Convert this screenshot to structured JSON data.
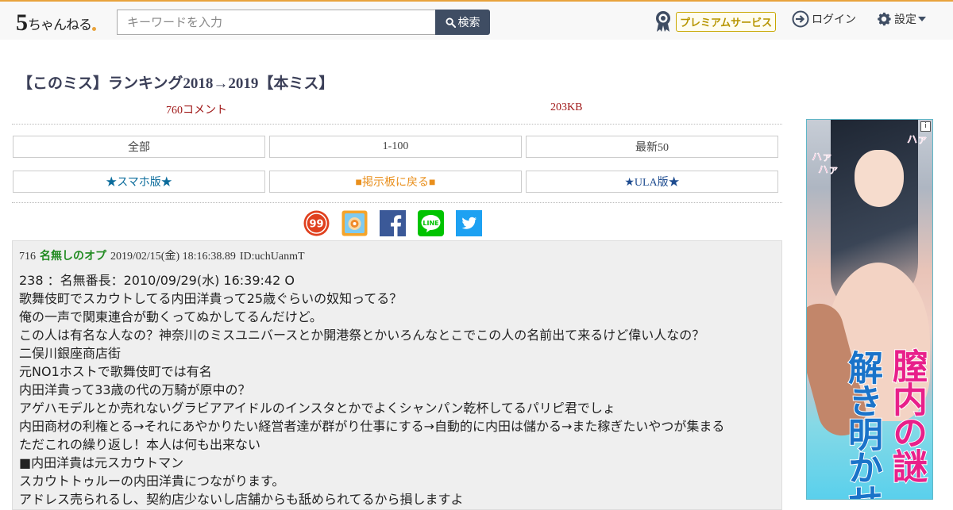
{
  "header": {
    "logo_five": "5",
    "logo_text": "ちゃんねる",
    "search_placeholder": "キーワードを入力",
    "search_button": "検索",
    "premium_label": "プレミアムサービス",
    "login_label": "ログイン",
    "settings_label": "設定",
    "accent_color": "#e8a33c"
  },
  "thread": {
    "title": "【このミス】ランキング2018→2019【本ミス】",
    "comments": "760コメント",
    "size": "203KB"
  },
  "nav": {
    "all": "全部",
    "range": "1-100",
    "latest": "最新50",
    "smartphone": "★スマホ版★",
    "back_to_board": "■掲示板に戻る■",
    "ula": "★ULA版★"
  },
  "share": {
    "icons": [
      "sukima-icon",
      "hatena-icon",
      "facebook-icon",
      "line-icon",
      "twitter-icon"
    ],
    "line_label": "LINE",
    "sukima_label": "99",
    "facebook_color": "#3b5998",
    "line_color": "#00c300",
    "twitter_color": "#1da1f2"
  },
  "post": {
    "number": "716",
    "name": "名無しのオプ",
    "date": "2019/02/15(金) 18:16:38.89",
    "id": "ID:uchUanmT",
    "lines": [
      "238 ：名無番長：2010/09/29(水) 16:39:42 O",
      "歌舞伎町でスカウトしてる内田洋貴って25歳ぐらいの奴知ってる？",
      "俺の一声で関東連合が動くってぬかしてるんだけど。",
      "この人は有名な人なの？神奈川のミスユニバースとか開港祭とかいろんなとこでこの人の名前出て来るけど偉い人なの？",
      "二俣川銀座商店街",
      "元NO1ホストで歌舞伎町では有名",
      "内田洋貴って33歳の代の万騎が原中の？",
      "アゲハモデルとか売れないグラビアアイドルのインスタとかでよくシャンパン乾杯してるパリピ君でしょ",
      "内田商材の利権とる→それにあやかりたい経営者達が群がり仕事にする→自動的に内田は儲かる→また稼ぎたいやつが集まる",
      "ただこれの繰り返し！本人は何も出来ない",
      "■内田洋貴は元スカウトマン",
      "スカウトトゥルーの内田洋貴につながります。",
      "アドレス売られるし、契約店少ないし店舗からも舐められてるから損しますよ"
    ]
  },
  "ad": {
    "info_label": "i",
    "sound1": "ハァ",
    "sound2": "ハァ",
    "sound3": "ハァ",
    "title_col1": "膣内の謎",
    "title_col2": "解き明かせ"
  }
}
